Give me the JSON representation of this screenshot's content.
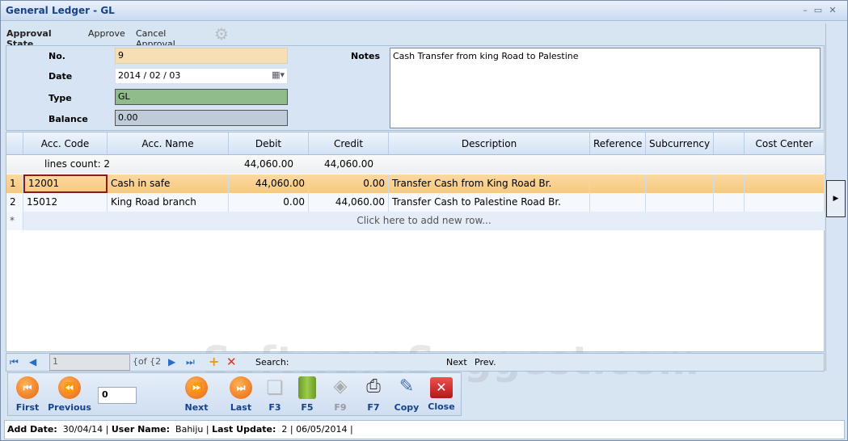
{
  "window": {
    "title": "General Ledger - GL"
  },
  "toolbar": {
    "approval_state": "Approval State",
    "approve": "Approve",
    "cancel_approval": "Cancel Approval"
  },
  "form": {
    "no_label": "No.",
    "no_value": "9",
    "date_label": "Date",
    "date_value": "2014 / 02 / 03",
    "type_label": "Type",
    "type_value": "GL",
    "balance_label": "Balance",
    "balance_value": "0.00",
    "notes_label": "Notes",
    "notes_value": "Cash Transfer from king Road to Palestine"
  },
  "grid": {
    "columns": [
      "Acc. Code",
      "Acc. Name",
      "Debit",
      "Credit",
      "Description",
      "Reference",
      "Subcurrency",
      "",
      "Cost Center"
    ],
    "summary": {
      "lines_count": "lines count: 2",
      "debit_total": "44,060.00",
      "credit_total": "44,060.00"
    },
    "rows": [
      {
        "num": "1",
        "code": "12001",
        "name": "Cash in safe",
        "debit": "44,060.00",
        "credit": "0.00",
        "description": "Transfer Cash from King Road Br."
      },
      {
        "num": "2",
        "code": "15012",
        "name": "King Road branch",
        "debit": "0.00",
        "credit": "44,060.00",
        "description": "Transfer Cash to Palestine Road Br."
      }
    ],
    "new_row_marker": "*",
    "new_row_text": "Click here to add new row..."
  },
  "navigator": {
    "page_value": "1",
    "of_text": "{of {2",
    "search_label": "Search:",
    "next": "Next",
    "prev": "Prev."
  },
  "buttons": {
    "first": "First",
    "previous": "Previous",
    "counter": "0",
    "next": "Next",
    "last": "Last",
    "f3": "F3",
    "f5": "F5",
    "f9": "F9",
    "f7": "F7",
    "copy": "Copy",
    "close": "Close"
  },
  "status": {
    "add_date_label": "Add Date:",
    "add_date": "30/04/14",
    "user_label": "User Name:",
    "user": "Bahiju",
    "last_update_label": "Last Update:",
    "last_update_count": "2",
    "last_update_date": "06/05/2014"
  },
  "watermark": "SoftwareSuggest.com"
}
